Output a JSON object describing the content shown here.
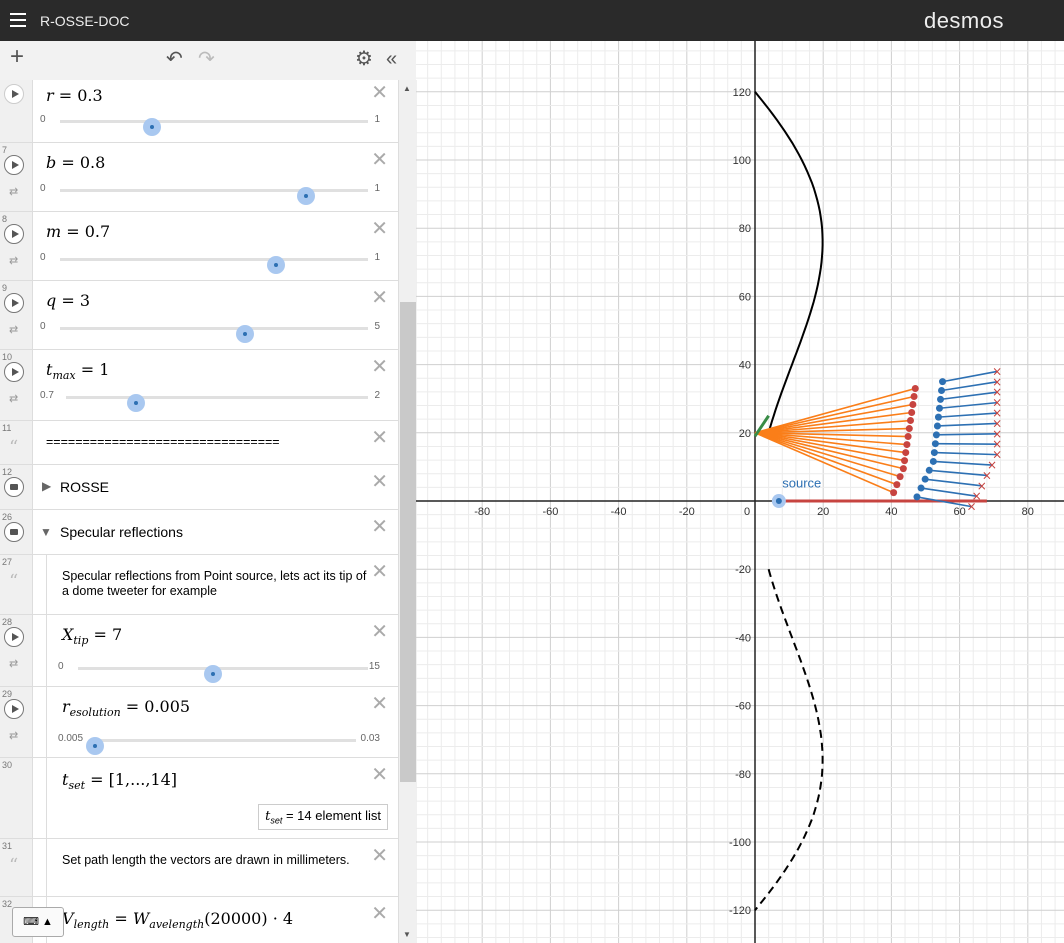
{
  "app": {
    "title": "R-OSSE-DOC",
    "logo": "desmos"
  },
  "expressions": {
    "r": {
      "lhs": "r",
      "value": "0.3",
      "min": "0",
      "max": "1",
      "pos": 0.3
    },
    "b": {
      "num": "7",
      "lhs": "b",
      "value": "0.8",
      "min": "0",
      "max": "1",
      "pos": 0.8
    },
    "m": {
      "num": "8",
      "lhs": "m",
      "value": "0.7",
      "min": "0",
      "max": "1",
      "pos": 0.7
    },
    "q": {
      "num": "9",
      "lhs": "q",
      "value": "3",
      "min": "0",
      "max": "5",
      "pos": 0.6
    },
    "tmax": {
      "num": "10",
      "lhs": "t",
      "sub": "max",
      "value": "1",
      "min": "0.7",
      "max": "2",
      "pos": 0.2307
    },
    "sep": {
      "num": "11",
      "text": "================================"
    },
    "rosse": {
      "num": "12",
      "label": "ROSSE"
    },
    "spec": {
      "num": "26",
      "label": "Specular reflections"
    },
    "note1": {
      "num": "27",
      "text": "Specular reflections from Point source, lets act its tip of a dome tweeter for example"
    },
    "xtip": {
      "num": "28",
      "lhs": "X",
      "sub": "tip",
      "value": "7",
      "min": "0",
      "max": "15",
      "pos": 0.4667
    },
    "res": {
      "num": "29",
      "lhs": "r",
      "sub": "esolution",
      "value": "0.005",
      "min": "0.005",
      "max": "0.03",
      "pos": 0.0
    },
    "tset": {
      "num": "30",
      "lhs": "t",
      "sub": "set",
      "rhs": "[1,...,14]",
      "eval_lhs": "t",
      "eval_sub": "set",
      "eval_rhs": "14 element list"
    },
    "note2": {
      "num": "31",
      "text": "Set path length the vectors are drawn in millimeters."
    },
    "vlen": {
      "num": "32",
      "lhs": "V",
      "sub": "length",
      "rhs1": "W",
      "rhs1_sub": "avelength",
      "arg": "(20000)",
      "mult": "· 4"
    }
  },
  "graph": {
    "x_ticks": [
      "-80",
      "-60",
      "-40",
      "-20",
      "0",
      "20",
      "40",
      "60",
      "80"
    ],
    "y_ticks": [
      "120",
      "100",
      "80",
      "60",
      "40",
      "20",
      "-20",
      "-40",
      "-60",
      "-80",
      "-100",
      "-120"
    ],
    "point_label": "source",
    "colors": {
      "curve": "#000000",
      "orange": "#fa7e19",
      "red": "#c74440",
      "blue": "#2d70b3",
      "green": "#388c46",
      "grid_minor": "#ececec",
      "grid_major": "#cfcfcf"
    }
  }
}
